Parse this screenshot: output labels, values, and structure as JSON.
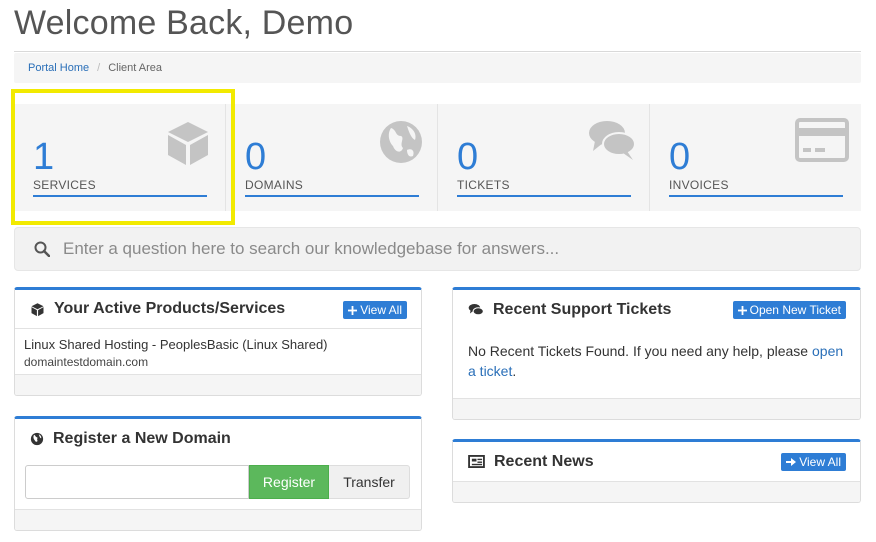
{
  "page": {
    "title": "Welcome Back, Demo"
  },
  "breadcrumb": {
    "home": "Portal Home",
    "separator": "/",
    "current": "Client Area"
  },
  "stats": [
    {
      "count": "1",
      "label": "SERVICES",
      "icon": "cube-icon"
    },
    {
      "count": "0",
      "label": "DOMAINS",
      "icon": "globe-icon"
    },
    {
      "count": "0",
      "label": "TICKETS",
      "icon": "comments-icon"
    },
    {
      "count": "0",
      "label": "INVOICES",
      "icon": "credit-card-icon"
    }
  ],
  "kb_search": {
    "placeholder": "Enter a question here to search our knowledgebase for answers...",
    "icon": "search-icon"
  },
  "products_panel": {
    "title": "Your Active Products/Services",
    "button": "View All",
    "items": [
      {
        "name": "Linux Shared Hosting - PeoplesBasic (Linux Shared)",
        "domain": "domaintestdomain.com"
      }
    ]
  },
  "domain_panel": {
    "title": "Register a New Domain",
    "input_value": "",
    "register_label": "Register",
    "transfer_label": "Transfer"
  },
  "tickets_panel": {
    "title": "Recent Support Tickets",
    "button": "Open New Ticket",
    "message": "No Recent Tickets Found. If you need any help, please",
    "link_text": "open a ticket",
    "message_end": "."
  },
  "news_panel": {
    "title": "Recent News",
    "button": "View All"
  },
  "colors": {
    "accent": "#2e7dd5",
    "register_green": "#5cb85c",
    "highlight": "#f2ea00",
    "stat_bg": "#f5f5f5"
  }
}
